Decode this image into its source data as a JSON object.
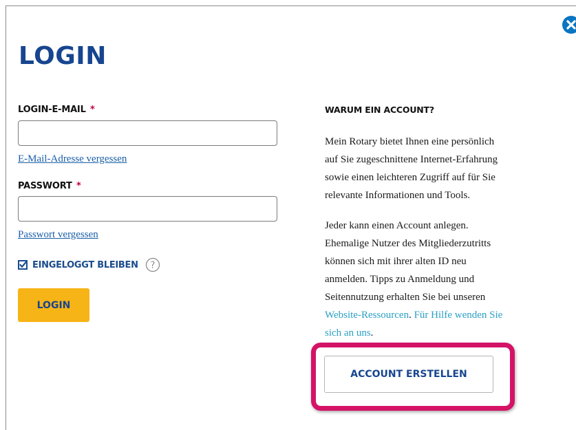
{
  "modal": {
    "title": "LOGIN",
    "close_icon": "close-icon"
  },
  "form": {
    "email_label": "LOGIN-E-MAIL",
    "email_required_mark": "*",
    "email_value": "",
    "email_forgot_link": "E-Mail-Adresse vergessen",
    "password_label": "PASSWORT",
    "password_required_mark": "*",
    "password_value": "",
    "password_forgot_link": "Passwort vergessen",
    "remember_label": "EINGELOGGT BLEIBEN",
    "remember_checked": true,
    "help_icon": "question-circle-icon",
    "login_button": "LOGIN"
  },
  "sidebar": {
    "heading": "WARUM EIN ACCOUNT?",
    "paragraph1_lines": [
      "Mein Rotary bietet Ihnen eine persönlich",
      "auf Sie zugeschnittene Internet-Erfahrung",
      "sowie einen leichteren Zugriff auf für Sie",
      "relevante Informationen und Tools."
    ],
    "paragraph2_lines": [
      "Jeder kann einen Account anlegen.",
      "Ehemalige Nutzer des Mitgliederzutritts",
      "können sich mit ihrer alten ID neu",
      "anmelden. Tipps zu Anmeldung und",
      "Seitennutzung erhalten Sie bei unseren"
    ],
    "resources_link": "Website-Ressourcen",
    "after_resources": ". ",
    "help_link_part1": "Für Hilfe wenden Sie",
    "help_link_part2": "sich an uns",
    "final_period": ".",
    "create_account_button": "ACCOUNT ERSTELLEN"
  },
  "colors": {
    "title_blue": "#17458f",
    "link_blue": "#1a5fa8",
    "inline_link_teal": "#2aa0c5",
    "required_red": "#c10042",
    "login_button_gold": "#f7b416",
    "highlight_magenta": "#d41367",
    "close_icon_blue": "#0a75c2"
  }
}
